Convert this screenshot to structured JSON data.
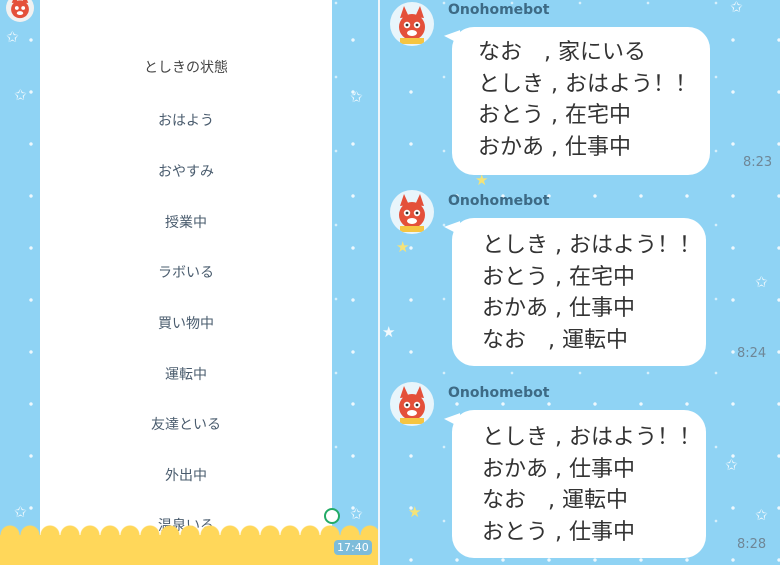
{
  "status_menu": {
    "title": "としきの状態",
    "items": [
      "おはよう",
      "おやすみ",
      "授業中",
      "ラボいる",
      "買い物中",
      "運転中",
      "友達といる",
      "外出中",
      "温泉いる"
    ],
    "clock": "17:40"
  },
  "chat": {
    "messages": [
      {
        "sender": "Onohomebot",
        "lines": [
          "なお　, 家にいる",
          "としき , おはよう！！",
          "おとう , 在宅中",
          "おかあ , 仕事中"
        ],
        "time": "8:23"
      },
      {
        "sender": "Onohomebot",
        "lines": [
          "としき , おはよう！！",
          "おとう , 在宅中",
          "おかあ , 仕事中",
          "なお　, 運転中"
        ],
        "time": "8:24"
      },
      {
        "sender": "Onohomebot",
        "lines": [
          "としき , おはよう！！",
          "おかあ , 仕事中",
          "なお　, 運転中",
          "おとう , 仕事中"
        ],
        "time": "8:28"
      }
    ]
  },
  "colors": {
    "background": "#8fd3f4",
    "bubble": "#ffffff",
    "bottom_strip": "#ffd75a"
  }
}
